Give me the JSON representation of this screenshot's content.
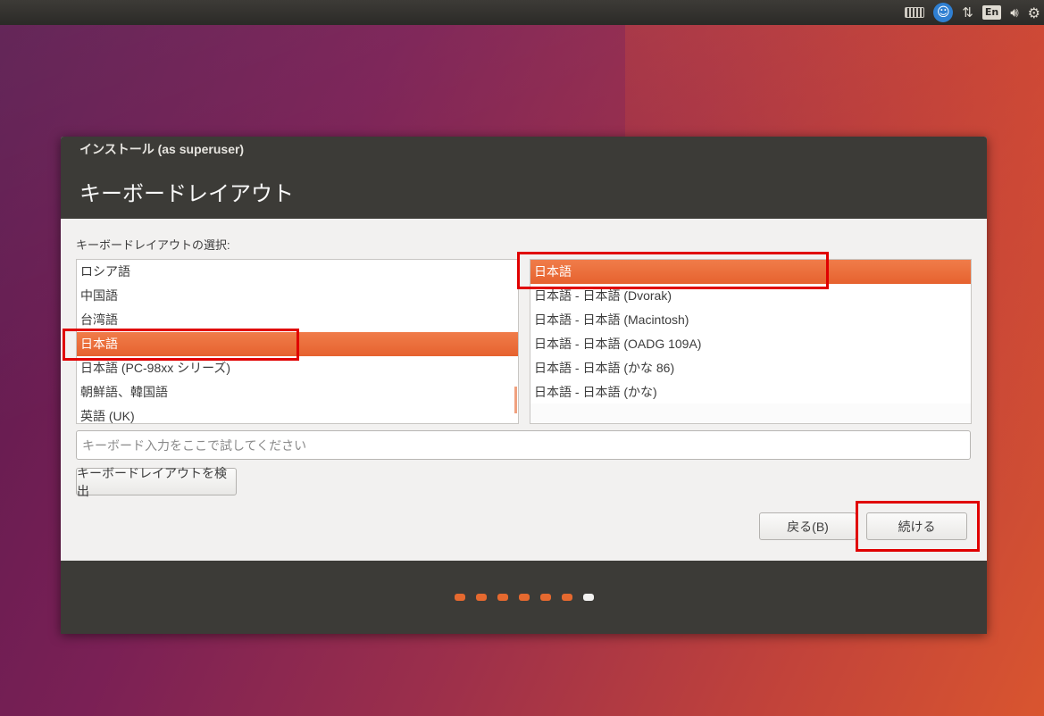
{
  "top_panel": {
    "language_indicator": "En",
    "icons": [
      "keyboard-icon",
      "accessibility-icon",
      "network-icon",
      "language-indicator",
      "volume-icon",
      "power-icon"
    ]
  },
  "window": {
    "title": "インストール (as superuser)",
    "heading": "キーボードレイアウト"
  },
  "layout_section": {
    "label": "キーボードレイアウトの選択:",
    "languages": [
      {
        "label": "ロシア語",
        "selected": false
      },
      {
        "label": "中国語",
        "selected": false
      },
      {
        "label": "台湾語",
        "selected": false
      },
      {
        "label": "日本語",
        "selected": true
      },
      {
        "label": "日本語 (PC-98xx シリーズ)",
        "selected": false
      },
      {
        "label": "朝鮮語、韓国語",
        "selected": false
      },
      {
        "label": "英語 (UK)",
        "selected": false
      }
    ],
    "variants": [
      {
        "label": "日本語",
        "selected": true
      },
      {
        "label": "日本語 - 日本語 (Dvorak)",
        "selected": false
      },
      {
        "label": "日本語 - 日本語 (Macintosh)",
        "selected": false
      },
      {
        "label": "日本語 - 日本語 (OADG 109A)",
        "selected": false
      },
      {
        "label": "日本語 - 日本語 (かな 86)",
        "selected": false
      },
      {
        "label": "日本語 - 日本語 (かな)",
        "selected": false
      }
    ]
  },
  "test_input": {
    "placeholder": "キーボード入力をここで試してください",
    "value": ""
  },
  "buttons": {
    "detect": "キーボードレイアウトを検出",
    "back": "戻る(B)",
    "continue": "続ける"
  },
  "progress": {
    "total_steps": 7,
    "current_step": 7
  },
  "colors": {
    "accent": "#e6622f",
    "highlight_box": "#e00000"
  }
}
